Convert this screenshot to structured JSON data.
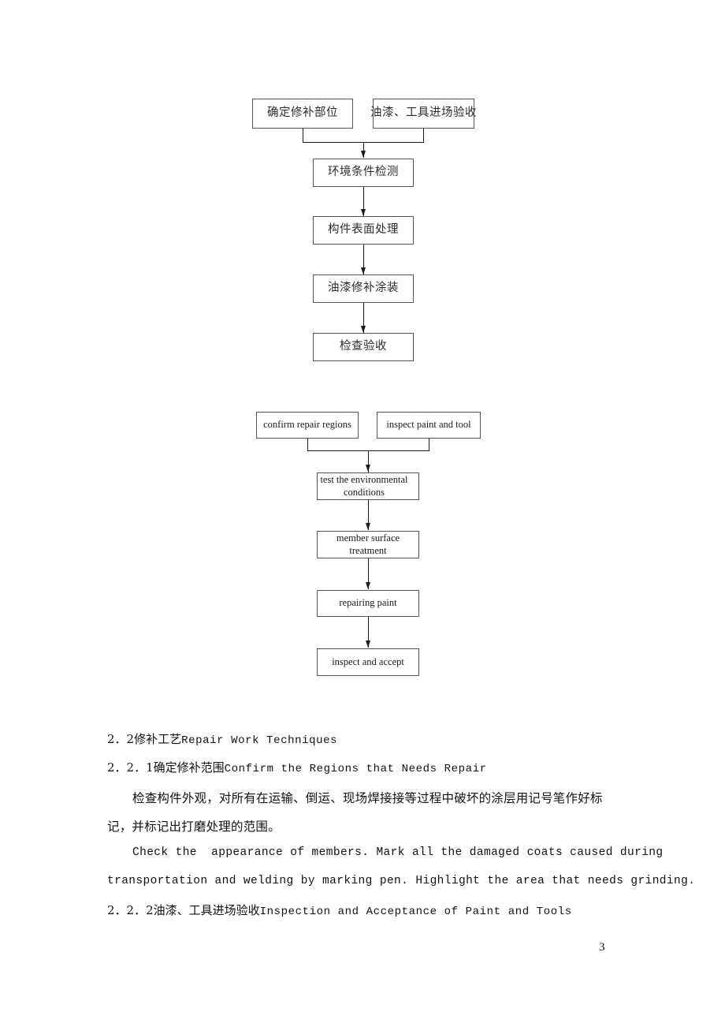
{
  "document": {
    "page_number": "3"
  },
  "flowchart_cn": {
    "name": "chinese-repair-process-flowchart",
    "nodes": [
      {
        "id": "confirm-repair-regions",
        "label": "确定修补部位"
      },
      {
        "id": "inspect-paint-and-tool",
        "label": "油漆、工具进场验收"
      },
      {
        "id": "test-environmental-conditions",
        "label": "环境条件检测"
      },
      {
        "id": "member-surface-treatment",
        "label": "构件表面处理"
      },
      {
        "id": "repairing-paint",
        "label": "油漆修补涂装"
      },
      {
        "id": "inspect-and-accept",
        "label": "检查验收"
      }
    ]
  },
  "flowchart_en": {
    "name": "english-repair-process-flowchart",
    "nodes": [
      {
        "id": "confirm-repair-regions",
        "label": "confirm repair regions"
      },
      {
        "id": "inspect-paint-and-tool",
        "label": "inspect paint and tool"
      },
      {
        "id": "test-environmental-conditions",
        "label": "test the environmental conditions"
      },
      {
        "id": "member-surface-treatment",
        "label": "member surface treatment"
      },
      {
        "id": "repairing-paint",
        "label": "repairing paint"
      },
      {
        "id": "inspect-and-accept",
        "label": "inspect and accept"
      }
    ]
  },
  "body": {
    "heading_2_2": "2．2修补工艺",
    "heading_2_2_en": "Repair Work Techniques",
    "heading_2_2_1": "2．2．1确定修补范围",
    "heading_2_2_1_en": "Confirm the Regions that Needs Repair",
    "para_cn_line1": "检查构件外观，对所有在运输、倒运、现场焊接接等过程中破坏的涂层用记号笔作好标",
    "para_cn_line2": "记，并标记出打磨处理的范围。",
    "para_en_line1": "Check the  appearance of members. Mark all the damaged coats caused during",
    "para_en_line2": "transportation and welding by marking pen. Highlight the area that needs grinding.",
    "heading_2_2_2": "2．2．2油漆、工具进场验收",
    "heading_2_2_2_en": "Inspection and Acceptance of Paint and Tools"
  }
}
